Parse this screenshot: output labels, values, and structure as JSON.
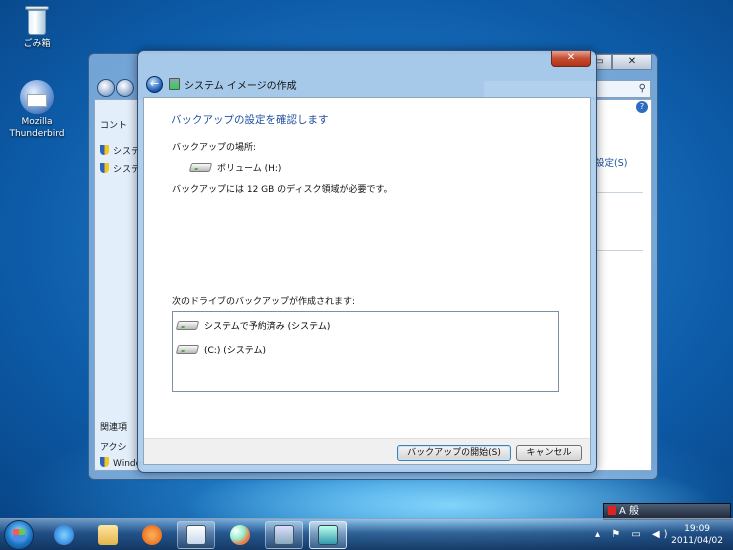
{
  "desktop": {
    "recycle_bin": "ごみ箱",
    "thunderbird_line1": "Mozilla",
    "thunderbird_line2": "Thunderbird"
  },
  "background_window": {
    "min_label": "▭",
    "max_label": "▭",
    "close_label": "✕",
    "search_icon": "⚲",
    "help_icon": "?",
    "left_items": [
      "コント",
      "システ",
      "システ"
    ],
    "left_bottom": [
      "関連項",
      "アクシ",
      "Windo"
    ],
    "right_link": "設定(S)"
  },
  "dialog": {
    "close_label": "✕",
    "title": "システム イメージの作成",
    "heading": "バックアップの設定を確認します",
    "location_label": "バックアップの場所:",
    "location_value": "ボリューム (H:)",
    "space_note": "バックアップには 12 GB のディスク領域が必要です。",
    "drives_label": "次のドライブのバックアップが作成されます:",
    "drives": [
      "システムで予約済み (システム)",
      "(C:) (システム)"
    ],
    "start_button": "バックアップの開始(S)",
    "cancel_button": "キャンセル"
  },
  "taskbar": {
    "time": "19:09",
    "date": "2011/04/02",
    "lang": "A 般"
  }
}
